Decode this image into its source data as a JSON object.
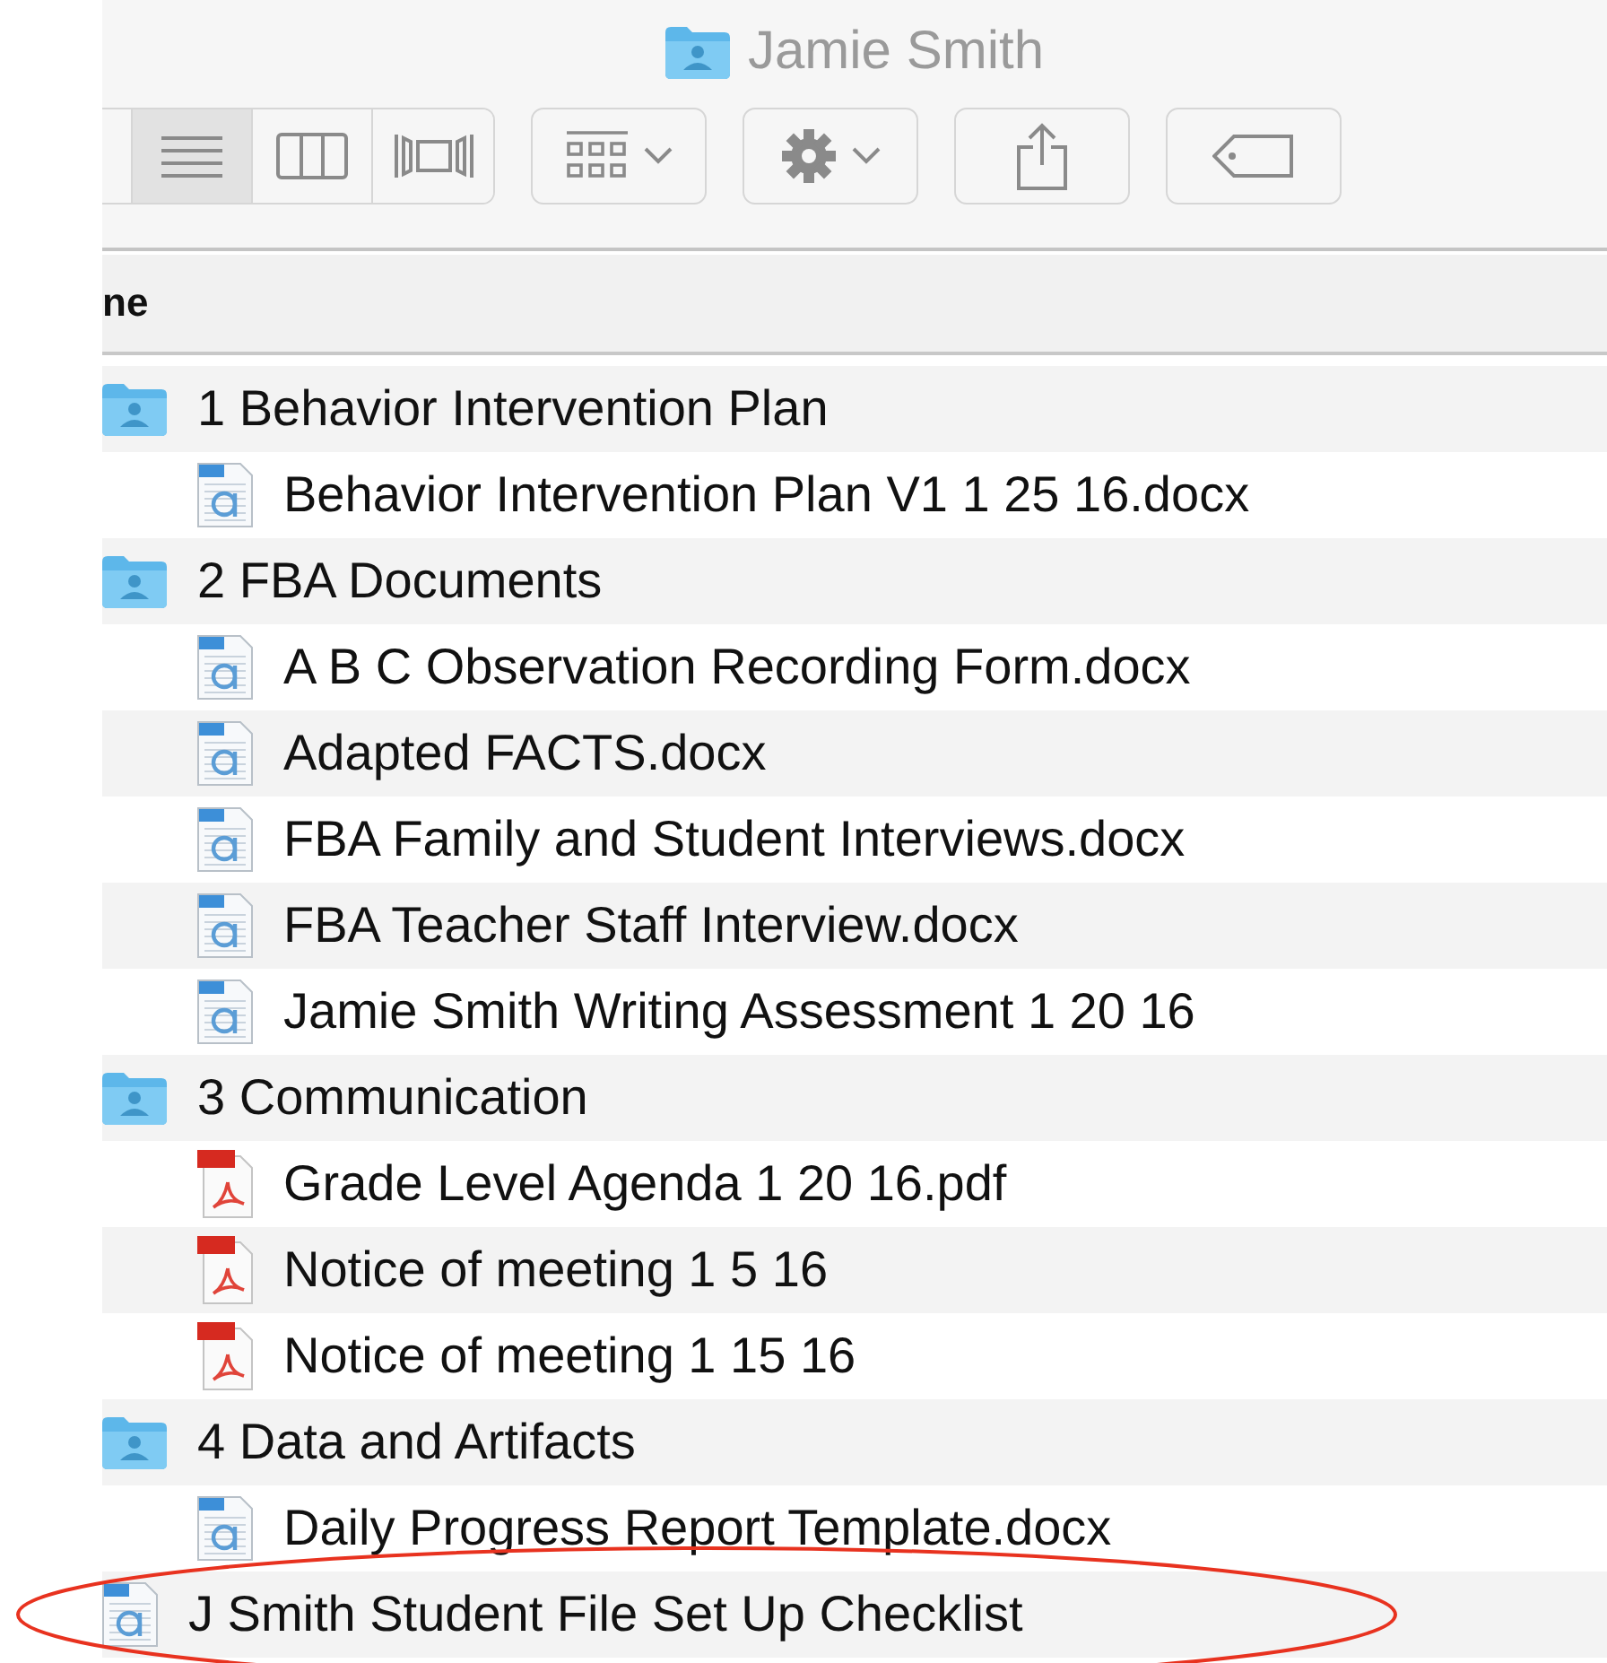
{
  "window": {
    "title": "Jamie Smith"
  },
  "toolbar": {
    "view_buttons": [
      {
        "kind": "list",
        "selected": true
      },
      {
        "kind": "columns",
        "selected": false
      },
      {
        "kind": "coverflow",
        "selected": false
      }
    ],
    "buttons": [
      {
        "kind": "arrange"
      },
      {
        "kind": "action"
      },
      {
        "kind": "share"
      },
      {
        "kind": "tags"
      }
    ]
  },
  "table": {
    "columns": [
      "ne"
    ],
    "rows": [
      {
        "name": "1 Behavior Intervention Plan",
        "kind": "folder",
        "children": [
          {
            "name": "Behavior Intervention Plan V1 1 25 16.docx",
            "kind": "docx"
          }
        ]
      },
      {
        "name": "2 FBA Documents",
        "kind": "folder",
        "children": [
          {
            "name": "A B C Observation Recording Form.docx",
            "kind": "docx"
          },
          {
            "name": "Adapted FACTS.docx",
            "kind": "docx"
          },
          {
            "name": "FBA Family and Student Interviews.docx",
            "kind": "docx"
          },
          {
            "name": "FBA Teacher Staff Interview.docx",
            "kind": "docx"
          },
          {
            "name": "Jamie Smith Writing Assessment 1 20 16",
            "kind": "docx"
          }
        ]
      },
      {
        "name": "3 Communication",
        "kind": "folder",
        "children": [
          {
            "name": "Grade Level Agenda 1 20 16.pdf",
            "kind": "pdf"
          },
          {
            "name": "Notice of meeting 1 5 16",
            "kind": "pdf"
          },
          {
            "name": "Notice of meeting 1 15 16",
            "kind": "pdf"
          }
        ]
      },
      {
        "name": "4 Data and Artifacts",
        "kind": "folder",
        "children": [
          {
            "name": "Daily Progress Report Template.docx",
            "kind": "docx"
          }
        ]
      },
      {
        "name": "J Smith Student File Set Up Checklist",
        "kind": "docx",
        "circled": true
      }
    ]
  }
}
